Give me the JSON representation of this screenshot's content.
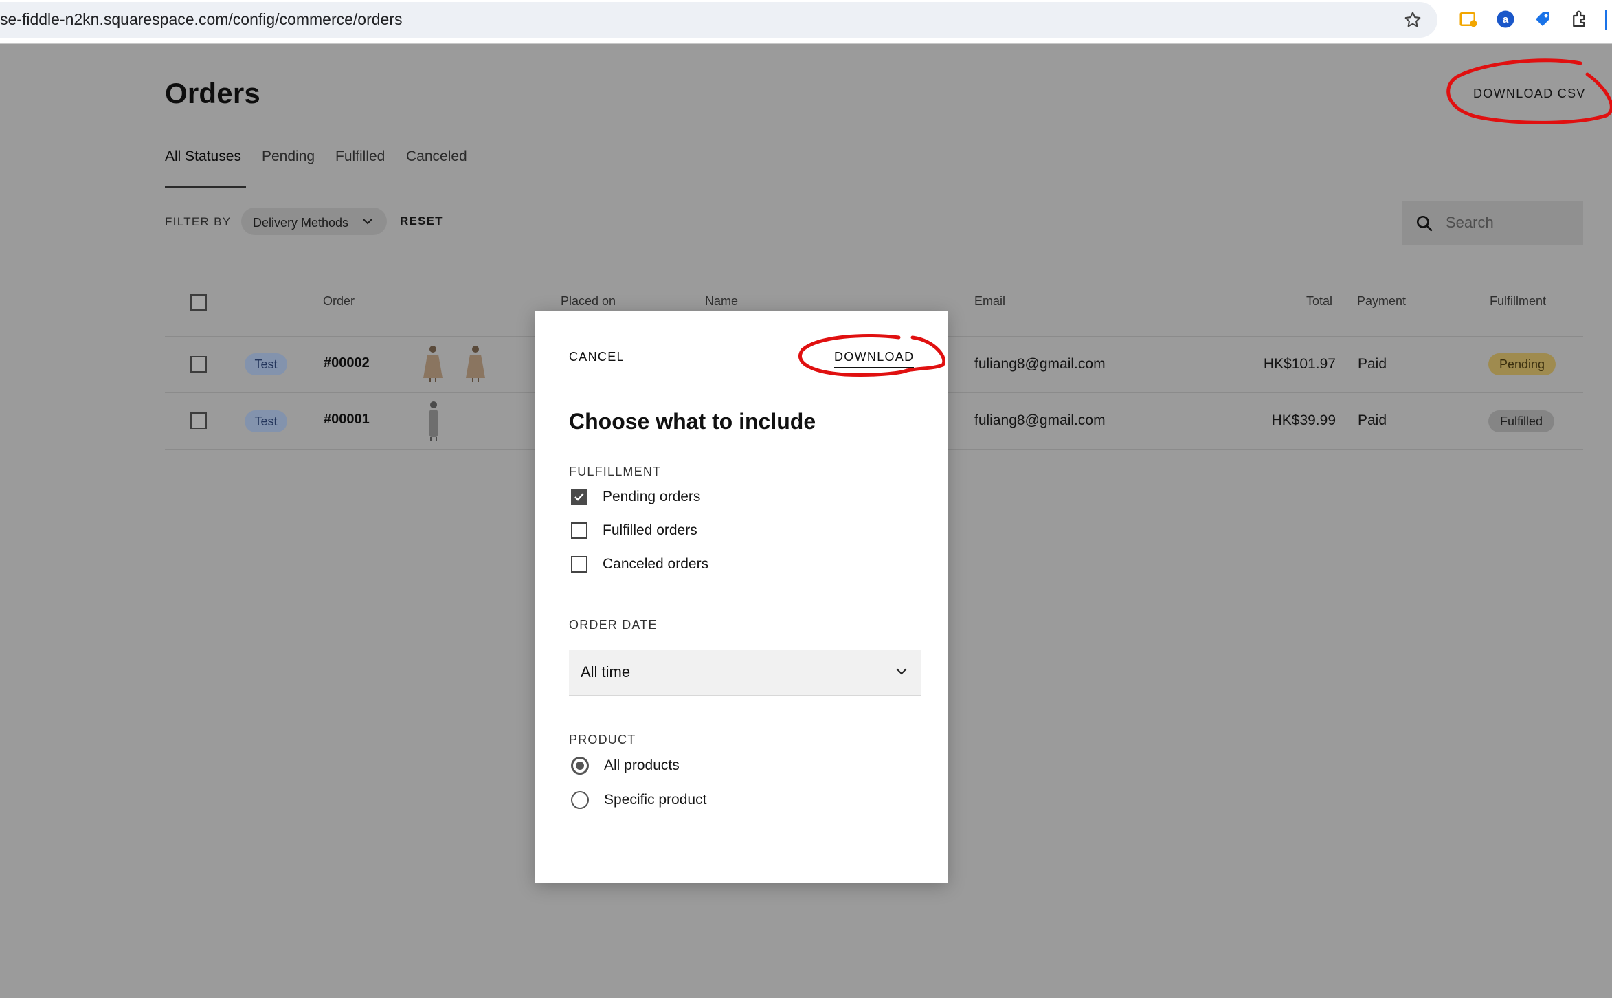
{
  "browser": {
    "url": "se-fiddle-n2kn.squarespace.com/config/commerce/orders"
  },
  "page": {
    "title": "Orders",
    "download_csv_label": "DOWNLOAD CSV",
    "tabs": [
      {
        "label": "All Statuses",
        "active": true
      },
      {
        "label": "Pending",
        "active": false
      },
      {
        "label": "Fulfilled",
        "active": false
      },
      {
        "label": "Canceled",
        "active": false
      }
    ],
    "filter": {
      "label": "FILTER BY",
      "delivery_methods": "Delivery Methods",
      "reset": "RESET"
    },
    "search": {
      "placeholder": "Search"
    },
    "table": {
      "headers": {
        "order": "Order",
        "placed_on": "Placed on",
        "name": "Name",
        "email": "Email",
        "total": "Total",
        "payment": "Payment",
        "fulfillment": "Fulfillment"
      },
      "rows": [
        {
          "tag": "Test",
          "order": "#00002",
          "email": "fuliang8@gmail.com",
          "total": "HK$101.97",
          "payment": "Paid",
          "fulfillment": "Pending"
        },
        {
          "tag": "Test",
          "order": "#00001",
          "email": "fuliang8@gmail.com",
          "total": "HK$39.99",
          "payment": "Paid",
          "fulfillment": "Fulfilled"
        }
      ]
    }
  },
  "modal": {
    "cancel": "CANCEL",
    "download": "DOWNLOAD",
    "title": "Choose what to include",
    "fulfillment": {
      "label": "FULFILLMENT",
      "options": [
        {
          "label": "Pending orders",
          "checked": true
        },
        {
          "label": "Fulfilled orders",
          "checked": false
        },
        {
          "label": "Canceled orders",
          "checked": false
        }
      ]
    },
    "order_date": {
      "label": "ORDER DATE",
      "value": "All time"
    },
    "product": {
      "label": "PRODUCT",
      "options": [
        {
          "label": "All products",
          "selected": true
        },
        {
          "label": "Specific product",
          "selected": false
        }
      ]
    }
  },
  "colors": {
    "annotation": "#e01010",
    "overlay_bg": "#9b9b9b",
    "pending_badge": "#9f8b4f",
    "test_tag": "#8393ad"
  }
}
